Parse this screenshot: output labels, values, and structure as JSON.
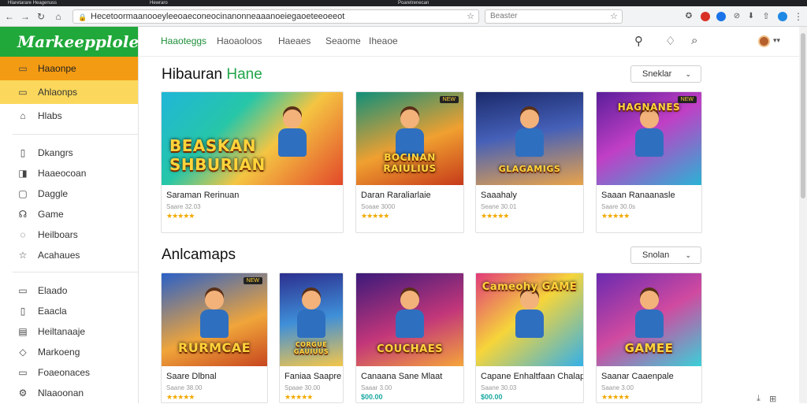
{
  "browser": {
    "tabs": [
      "Hlaretarare Heagenuss",
      "Hewraro",
      "Poaretrenecan"
    ],
    "url": "Hecetoormaanooeyleeoaeconeocinanonneaaanoeiegaoeteeoeeot",
    "search_placeholder": "Beaster"
  },
  "sidebar": {
    "logo": "Markeepplolee",
    "items": [
      {
        "label": "Haaonpe",
        "icon": "home-icon"
      },
      {
        "label": "Ahlaonps",
        "icon": "apps-icon"
      },
      {
        "label": "Hlabs",
        "icon": "home-outline-icon"
      },
      {
        "label": "Dkangrs",
        "icon": "document-icon"
      },
      {
        "label": "Haaeocoan",
        "icon": "bookmark-icon"
      },
      {
        "label": "Daggle",
        "icon": "page-icon"
      },
      {
        "label": "Game",
        "icon": "gamepad-icon"
      },
      {
        "label": "Heilboars",
        "icon": "globe-icon"
      },
      {
        "label": "Acahaues",
        "icon": "star-icon"
      },
      {
        "label": "Elaado",
        "icon": "inbox-icon"
      },
      {
        "label": "Eaacla",
        "icon": "file-icon"
      },
      {
        "label": "Heiltanaaje",
        "icon": "calendar-icon"
      },
      {
        "label": "Markoeng",
        "icon": "tag-icon"
      },
      {
        "label": "Foaeonaces",
        "icon": "folder-icon"
      },
      {
        "label": "Nlaaoonan",
        "icon": "settings-icon"
      }
    ]
  },
  "topnav": {
    "tabs": [
      "Haaoteggs",
      "Haoaoloos",
      "Haeaes",
      "Seaome",
      "Iheaoe"
    ]
  },
  "sections": [
    {
      "title": "Hibauran",
      "accent": "Hane",
      "sort_label": "Sneklar",
      "cards": [
        {
          "title": "Saraman Rerinuan",
          "price": "Saare 32.03",
          "stars": "★★★★★",
          "art_text": "BEASKAN SHBURIAN",
          "badge": ""
        },
        {
          "title": "Daran Raraliarlaie",
          "price": "Soaae 3000",
          "stars": "★★★★★",
          "art_text": "BOCINAN RAIULIUS",
          "badge": "NEW"
        },
        {
          "title": "Saaahaly",
          "price": "Seane 30.01",
          "stars": "★★★★★",
          "art_text": "GLAGAMIGS",
          "badge": ""
        },
        {
          "title": "Saaan Ranaanasle",
          "price": "Saare 30.0s",
          "stars": "★★★★★",
          "art_text": "HAGNANES",
          "badge": "NEW"
        }
      ]
    },
    {
      "title": "Anlcamaps",
      "accent": "",
      "sort_label": "Snolan",
      "cards": [
        {
          "title": "Saare Dlbnal",
          "price": "Saane 38.00",
          "stars": "★★★★★",
          "price2": "",
          "art_text": "RURMCAE",
          "badge": "NEW"
        },
        {
          "title": "Faniaa Saapre",
          "price": "Spaae 30.00",
          "stars": "★★★★★",
          "price2": "",
          "art_text": "CORGUE GAUIUUS",
          "badge": ""
        },
        {
          "title": "Canaana Sane Mlaat",
          "price": "Saaar 3.00",
          "stars": "",
          "price2": "$00.00",
          "art_text": "COUCHAES",
          "badge": ""
        },
        {
          "title": "Capane Enhaltfaan Chalapraadt",
          "price": "Saane 30.03",
          "stars": "",
          "price2": "$00.00",
          "art_text": "Cameohy GAME",
          "badge": ""
        },
        {
          "title": "Saanar Caaenpale",
          "price": "Saane 3.00",
          "stars": "★★★★★",
          "price2": "",
          "art_text": "GAMEE",
          "badge": ""
        }
      ]
    }
  ],
  "colors": {
    "brand_green": "#20a83a",
    "active_orange": "#f39b12",
    "selected_yellow": "#fbd85b"
  }
}
